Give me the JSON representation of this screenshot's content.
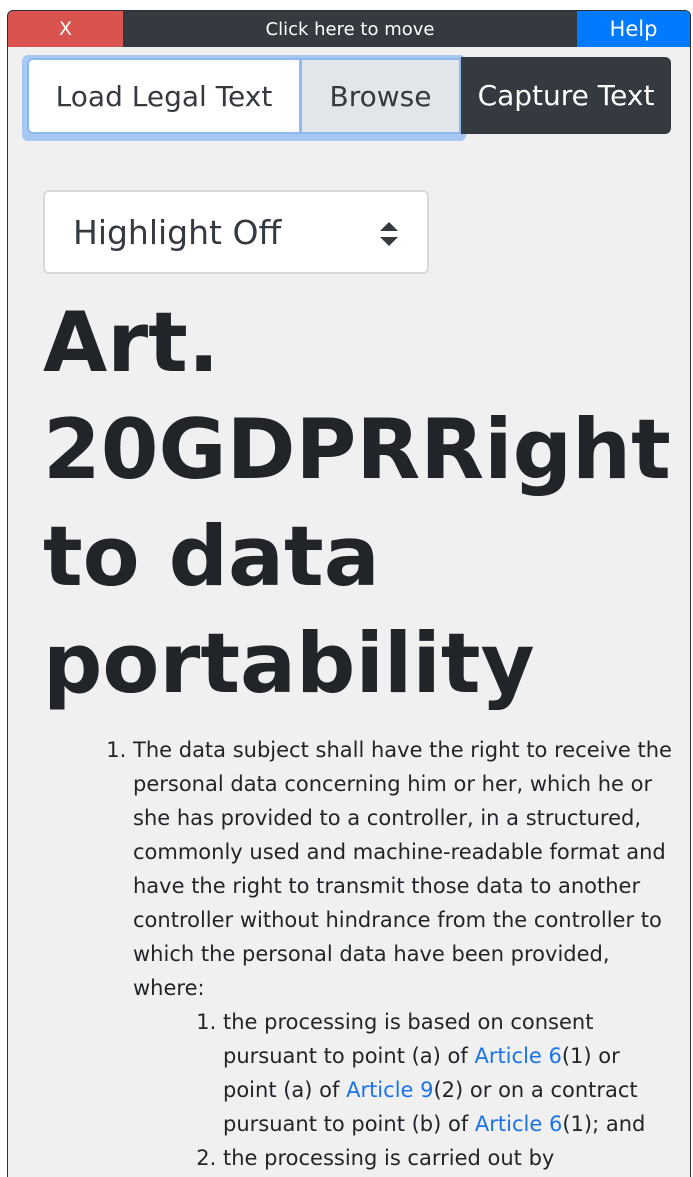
{
  "toolbar": {
    "close_label": "X",
    "move_label": "Click here to move",
    "help_label": "Help"
  },
  "actions": {
    "load_label": "Load Legal Text",
    "browse_label": "Browse",
    "capture_label": "Capture Text"
  },
  "highlight_select": {
    "selected": "Highlight Off"
  },
  "article": {
    "title": "Art. 20GDPRRight to data portability",
    "item1_text": "The data subject shall have the right to receive the personal data concerning him or her, which he or she has provided to a controller, in a structured, commonly used and machine-readable format and have the right to transmit those data to another controller without hindrance from the controller to which the personal data have been provided, where:",
    "sub1": {
      "t1": "the processing is based on consent pursuant to point (a) of ",
      "link1": "Article 6",
      "t2": "(1) or point (a) of ",
      "link2": "Article 9",
      "t3": "(2) or on a contract pursuant to point (b) of ",
      "link3": "Article 6",
      "t4": "(1); and"
    },
    "sub2_text": "the processing is carried out by automated means."
  },
  "colors": {
    "toolbar_bg": "#343a40",
    "close_bg": "#d9534f",
    "help_bg": "#007bff",
    "link": "#1a73e8",
    "page_bg": "#f0f0f0"
  }
}
